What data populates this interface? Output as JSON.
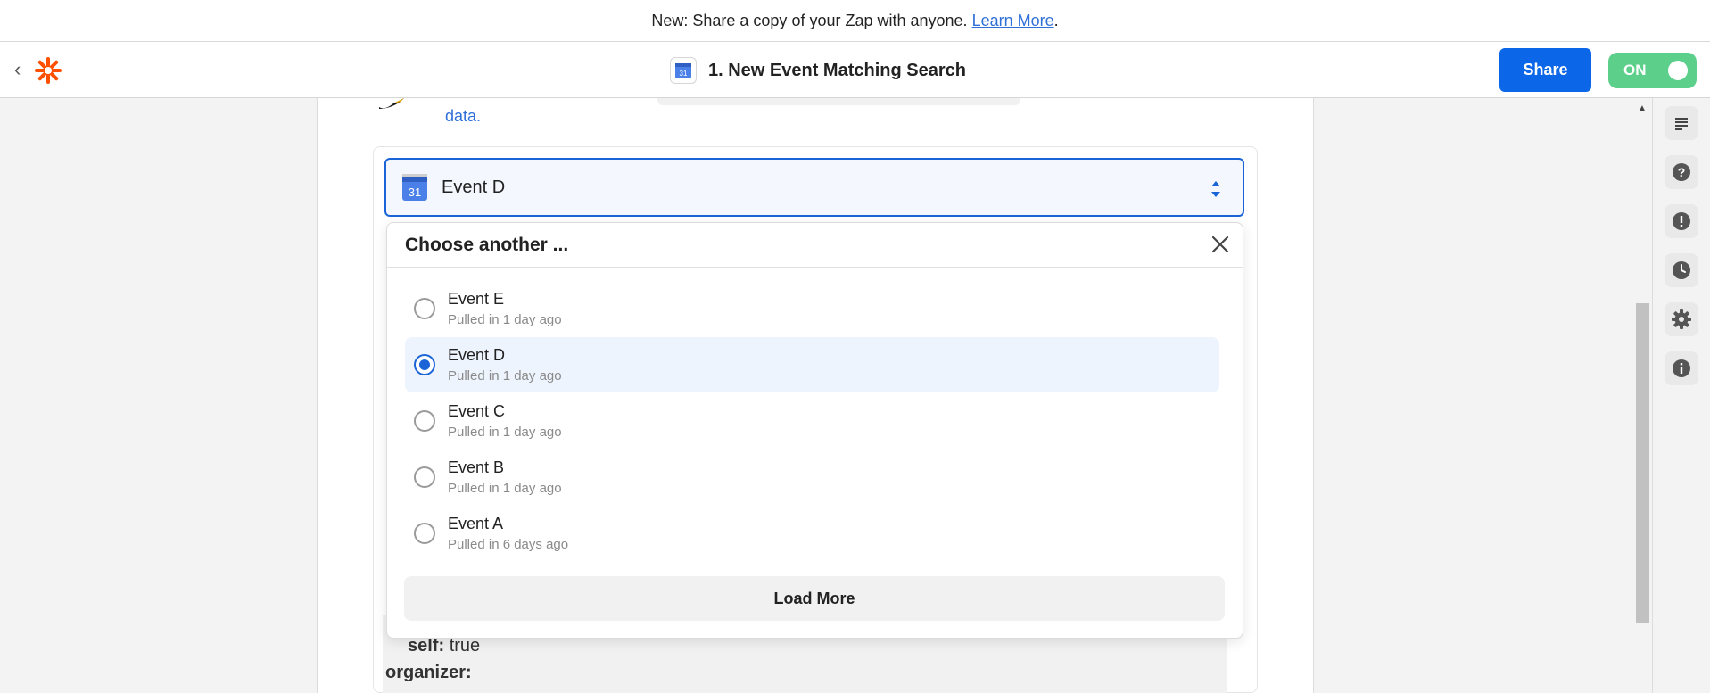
{
  "banner": {
    "text": "New: Share a copy of your Zap with anyone.",
    "link": "Learn More",
    "suffix": "."
  },
  "header": {
    "title": "1. New Event Matching Search",
    "share_label": "Share",
    "toggle_label": "ON",
    "calendar_icon_day": "31"
  },
  "colors": {
    "accent": "#0b66e8",
    "toggle_on": "#5ccf8b",
    "logo": "#ff4f00"
  },
  "step": {
    "data_link": "data."
  },
  "select": {
    "value": "Event D",
    "calendar_icon_day": "31"
  },
  "dropdown": {
    "title": "Choose another ...",
    "options": [
      {
        "name": "Event E",
        "sub": "Pulled in 1 day ago",
        "selected": false
      },
      {
        "name": "Event D",
        "sub": "Pulled in 1 day ago",
        "selected": true
      },
      {
        "name": "Event C",
        "sub": "Pulled in 1 day ago",
        "selected": false
      },
      {
        "name": "Event B",
        "sub": "Pulled in 1 day ago",
        "selected": false
      },
      {
        "name": "Event A",
        "sub": "Pulled in 6 days ago",
        "selected": false
      }
    ],
    "load_more": "Load More"
  },
  "record": {
    "self_key": "self:",
    "self_value": "true",
    "organizer_key": "organizer:"
  },
  "rail_icons": [
    "list-icon",
    "help-icon",
    "alert-icon",
    "clock-icon",
    "gear-icon",
    "info-icon"
  ]
}
